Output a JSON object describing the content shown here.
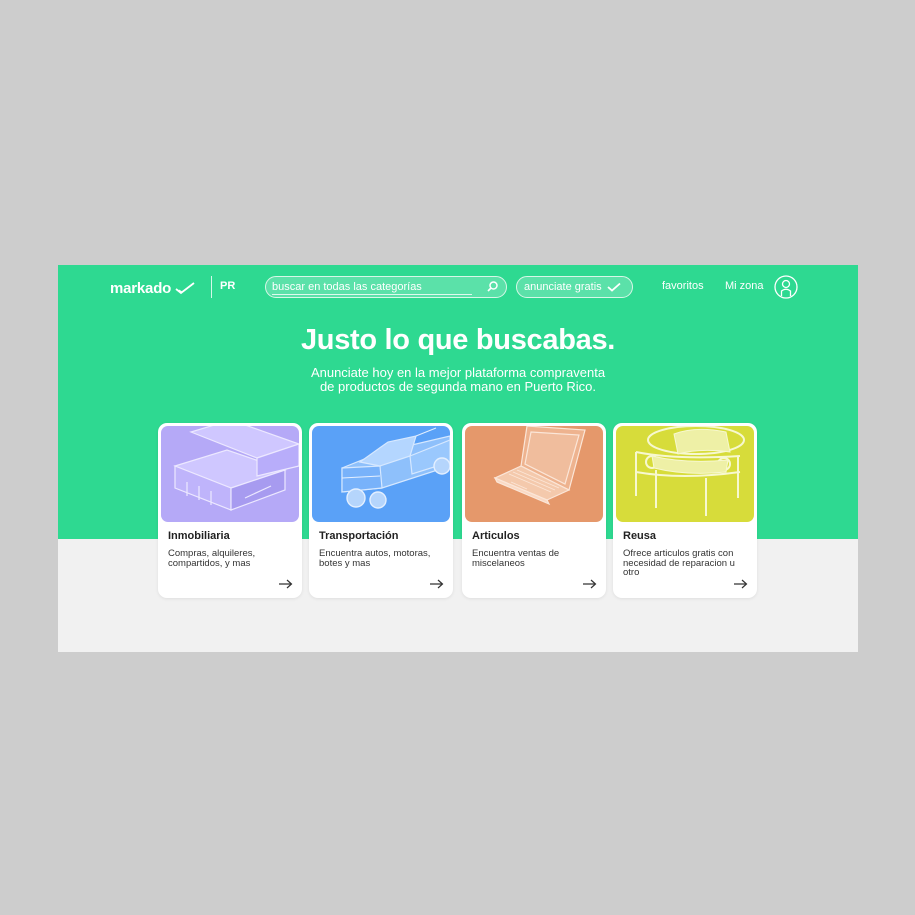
{
  "header": {
    "logo_text": "markado",
    "region": "PR",
    "search_placeholder": "buscar en todas las categorías",
    "post_button": "anunciate gratis",
    "favorites": "favoritos",
    "my_zone": "Mi zona"
  },
  "hero": {
    "title": "Justo lo que buscabas.",
    "subtitle_line1": "Anunciate hoy en la mejor plataforma compraventa",
    "subtitle_line2": "de productos de segunda mano en Puerto Rico."
  },
  "categories": [
    {
      "title": "Inmobiliaria",
      "desc": "Compras, alquileres, compartidos, y mas",
      "color": "#b5a9f7",
      "icon": "house-icon"
    },
    {
      "title": "Transportación",
      "desc": "Encuentra autos, motoras, botes y mas",
      "color": "#5aa1f7",
      "icon": "truck-icon"
    },
    {
      "title": "Articulos",
      "desc": "Encuentra ventas de miscelaneos",
      "color": "#e5986b",
      "icon": "laptop-icon"
    },
    {
      "title": "Reusa",
      "desc": "Ofrece articulos gratis con necesidad de reparacion u otro",
      "color": "#d7dc3a",
      "icon": "bench-icon"
    }
  ],
  "colors": {
    "brand_green": "#2ed991",
    "background": "#f1f1f1"
  }
}
